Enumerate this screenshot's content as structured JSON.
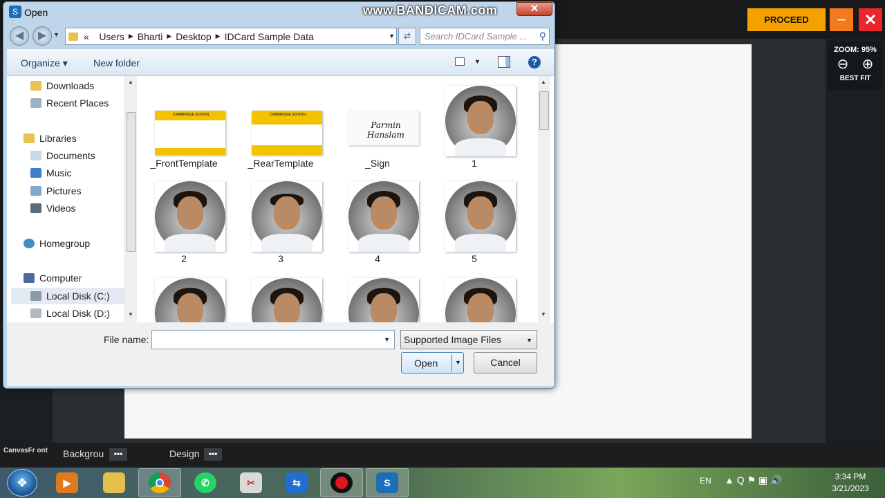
{
  "app": {
    "proceed_label": "PROCEED",
    "minimize_label": "−",
    "close_label": "✕",
    "zoom_label": "ZOOM: 95%",
    "zoom_out_icon": "⊖",
    "zoom_in_icon": "⊕",
    "best_fit_label": "BEST FIT",
    "canvas_front_label": "CanvasFr ont",
    "tab_background_label": "Backgrou",
    "tab_design_label": "Design",
    "more_label": "•••"
  },
  "dialog": {
    "title": "Open",
    "watermark": "www.BANDICAM.com",
    "close_label": "✕",
    "address_prefix": "«",
    "breadcrumb": [
      "Users",
      "Bharti",
      "Desktop",
      "IDCard Sample Data"
    ],
    "search_placeholder": "Search IDCard Sample ...",
    "toolbar": {
      "organize_label": "Organize ▾",
      "new_folder_label": "New folder",
      "help_label": "?"
    },
    "nav_items": [
      {
        "label": "Downloads",
        "icon": "downloads-icon",
        "color": "#e7c255"
      },
      {
        "label": "Recent Places",
        "icon": "recent-places-icon",
        "color": "#9bb3c9"
      },
      {
        "label": "Libraries",
        "icon": "libraries-icon",
        "color": "#e7c255"
      },
      {
        "label": "Documents",
        "icon": "documents-icon",
        "color": "#c9d8e8"
      },
      {
        "label": "Music",
        "icon": "music-icon",
        "color": "#3f7fc4"
      },
      {
        "label": "Pictures",
        "icon": "pictures-icon",
        "color": "#7fa8cf"
      },
      {
        "label": "Videos",
        "icon": "videos-icon",
        "color": "#5a6b7c"
      },
      {
        "label": "Homegroup",
        "icon": "homegroup-icon",
        "color": "#3f8fc4"
      },
      {
        "label": "Computer",
        "icon": "computer-icon",
        "color": "#4a6aa0"
      },
      {
        "label": "Local Disk (C:)",
        "icon": "local-disk-icon",
        "color": "#8a9aa8"
      },
      {
        "label": "Local Disk (D:)",
        "icon": "local-disk-icon",
        "color": "#b0b8c0"
      }
    ],
    "files": [
      {
        "label": "_FrontTemplate",
        "kind": "card"
      },
      {
        "label": "_RearTemplate",
        "kind": "card"
      },
      {
        "label": "_Sign",
        "kind": "signature"
      },
      {
        "label": "1",
        "kind": "photo"
      },
      {
        "label": "2",
        "kind": "photo"
      },
      {
        "label": "3",
        "kind": "photo"
      },
      {
        "label": "4",
        "kind": "photo"
      },
      {
        "label": "5",
        "kind": "photo"
      },
      {
        "label": "",
        "kind": "photo"
      },
      {
        "label": "",
        "kind": "photo"
      },
      {
        "label": "",
        "kind": "photo"
      },
      {
        "label": "",
        "kind": "photo"
      }
    ],
    "card_text": "CAMBRIDGE SCHOOL",
    "signature_text": "Parmin Hanslam",
    "file_name_label": "File name:",
    "file_name_value": "",
    "filter_value": "Supported Image Files",
    "open_label": "Open",
    "cancel_label": "Cancel"
  },
  "taskbar": {
    "lang": "EN",
    "tray_text": "▲  Q  ⚑  ▣  🔊",
    "time": "3:34 PM",
    "date": "3/21/2023"
  }
}
